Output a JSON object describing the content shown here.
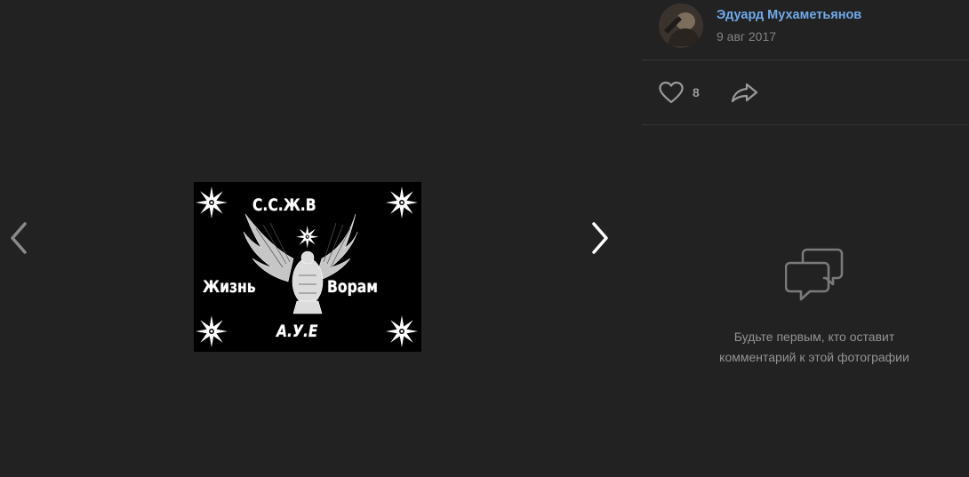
{
  "viewer": {
    "prev_icon": "chevron-left-icon",
    "next_icon": "chevron-right-icon",
    "photo": {
      "top_text": "С.С.Ж.В",
      "left_text": "Жизнь",
      "right_text": "Ворам",
      "bottom_text": "А.У.Е"
    }
  },
  "author": {
    "name": "Эдуард Мухаметьянов",
    "date": "9 авг 2017"
  },
  "actions": {
    "like_icon": "heart-icon",
    "like_count": "8",
    "share_icon": "share-icon"
  },
  "comments": {
    "empty_icon": "comment-icon",
    "empty_line1": "Будьте первым, кто оставит",
    "empty_line2": "комментарий к этой фотографии"
  },
  "colors": {
    "background": "#222222",
    "link": "#71aaeb",
    "muted": "#828282",
    "divider": "#363738"
  }
}
